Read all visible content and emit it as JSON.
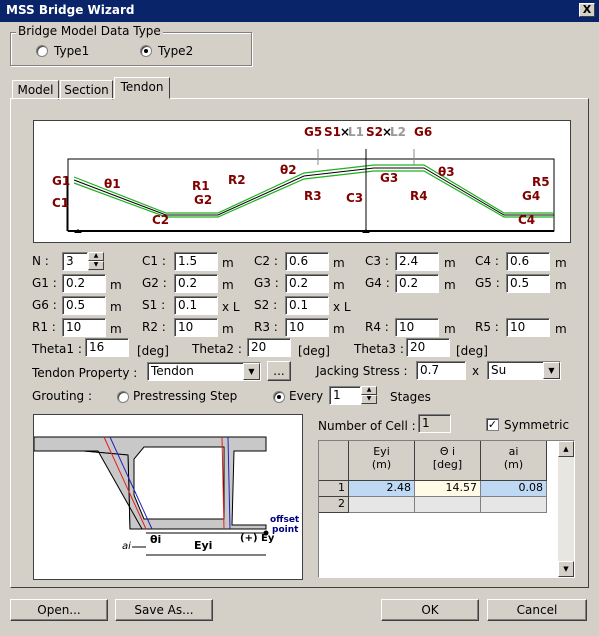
{
  "window": {
    "title": "MSS Bridge Wizard",
    "close": "X"
  },
  "model_type": {
    "legend": "Bridge Model Data Type",
    "type1": "Type1",
    "type2": "Type2",
    "selected": "type2"
  },
  "tabs": [
    {
      "label": "Model"
    },
    {
      "label": "Section"
    },
    {
      "label": "Tendon"
    }
  ],
  "diagram_labels": {
    "G5": "G5",
    "S1": "S1",
    "L1": "L1",
    "S2": "S2",
    "L2": "L2",
    "G6": "G6",
    "G1": "G1",
    "C1": "C1",
    "theta1": "θ1",
    "R1": "R1",
    "R2": "R2",
    "G2": "G2",
    "C2": "C2",
    "theta2": "θ2",
    "R3": "R3",
    "C3": "C3",
    "G3": "G3",
    "R4": "R4",
    "theta3": "θ3",
    "R5": "R5",
    "G4": "G4",
    "C4": "C4",
    "times": "×"
  },
  "params": {
    "N": {
      "label": "N :",
      "value": "3"
    },
    "C1": {
      "label": "C1 :",
      "value": "1.5",
      "unit": "m"
    },
    "C2": {
      "label": "C2 :",
      "value": "0.6",
      "unit": "m"
    },
    "C3": {
      "label": "C3 :",
      "value": "2.4",
      "unit": "m"
    },
    "C4": {
      "label": "C4 :",
      "value": "0.6",
      "unit": "m"
    },
    "G1": {
      "label": "G1 :",
      "value": "0.2",
      "unit": "m"
    },
    "G2": {
      "label": "G2 :",
      "value": "0.2",
      "unit": "m"
    },
    "G3": {
      "label": "G3 :",
      "value": "0.2",
      "unit": "m"
    },
    "G4": {
      "label": "G4 :",
      "value": "0.2",
      "unit": "m"
    },
    "G5": {
      "label": "G5 :",
      "value": "0.5",
      "unit": "m"
    },
    "G6": {
      "label": "G6 :",
      "value": "0.5",
      "unit": "m"
    },
    "S1": {
      "label": "S1 :",
      "value": "0.1",
      "unit": "x L"
    },
    "S2": {
      "label": "S2 :",
      "value": "0.1",
      "unit": "x L"
    },
    "R1": {
      "label": "R1 :",
      "value": "10",
      "unit": "m"
    },
    "R2": {
      "label": "R2 :",
      "value": "10",
      "unit": "m"
    },
    "R3": {
      "label": "R3 :",
      "value": "10",
      "unit": "m"
    },
    "R4": {
      "label": "R4 :",
      "value": "10",
      "unit": "m"
    },
    "R5": {
      "label": "R5 :",
      "value": "10",
      "unit": "m"
    },
    "Theta1": {
      "label": "Theta1 :",
      "value": "16",
      "unit": "[deg]"
    },
    "Theta2": {
      "label": "Theta2 :",
      "value": "20",
      "unit": "[deg]"
    },
    "Theta3": {
      "label": "Theta3 :",
      "value": "20",
      "unit": "[deg]"
    }
  },
  "tendon_property": {
    "label": "Tendon Property :",
    "value": "Tendon",
    "browse": "..."
  },
  "jacking": {
    "label": "Jacking Stress :",
    "value": "0.7",
    "times": "x",
    "select": "Su"
  },
  "grouting": {
    "label": "Grouting :",
    "opt1": "Prestressing Step",
    "opt2": "Every",
    "every_value": "1",
    "stages": "Stages",
    "selected": "every"
  },
  "cells": {
    "label": "Number of Cell :",
    "value": "1",
    "symmetric": "Symmetric",
    "symmetric_checked": true
  },
  "section_labels": {
    "ai": "ai",
    "theta_i": "θi",
    "ey": "Eyi",
    "plus_ey": "(+) Ey",
    "offset": "offset",
    "point": "point"
  },
  "table": {
    "headers": [
      {
        "line1": "Eyi",
        "line2": "(m)"
      },
      {
        "line1": "Θ i",
        "line2": "[deg]"
      },
      {
        "line1": "ai",
        "line2": "(m)"
      }
    ],
    "rows": [
      {
        "num": "1",
        "eyi": "2.48",
        "theta": "14.57",
        "ai": "0.08"
      },
      {
        "num": "2",
        "eyi": "",
        "theta": "",
        "ai": ""
      }
    ]
  },
  "buttons": {
    "open": "Open...",
    "save_as": "Save As...",
    "ok": "OK",
    "cancel": "Cancel"
  }
}
